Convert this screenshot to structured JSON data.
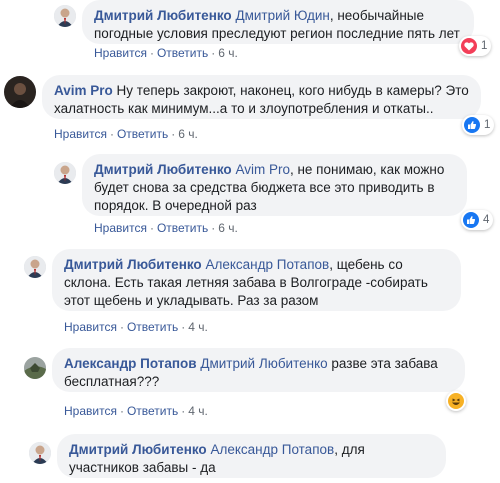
{
  "comments": [
    {
      "author": "Дмитрий Любитенко",
      "mention": "Дмитрий Юдин",
      "text": ", необычайные погодные условия преследуют регион последние пять лет",
      "like_label": "Нравится",
      "reply_label": "Ответить",
      "time": "6 ч.",
      "reaction": "love-icon",
      "reaction_count": "1"
    },
    {
      "author": "Avim Pro",
      "mention": "",
      "text": "Ну теперь закроют, наконец, кого нибудь в камеры? Это халатность как минимум...а то и злоупотребления и откаты..",
      "like_label": "Нравится",
      "reply_label": "Ответить",
      "time": "6 ч.",
      "reaction": "like-icon",
      "reaction_count": "1"
    },
    {
      "author": "Дмитрий Любитенко",
      "mention": "Avim Pro",
      "text": ", не понимаю, как можно будет снова за средства бюджета все это приводить в порядок. В очередной раз",
      "like_label": "Нравится",
      "reply_label": "Ответить",
      "time": "6 ч.",
      "reaction": "like-icon",
      "reaction_count": "4"
    },
    {
      "author": "Дмитрий Любитенко",
      "mention": "Александр Потапов",
      "text": ", щебень со склона. Есть такая летняя забава в Волгограде -собирать этот щебень и укладывать. Раз за разом",
      "like_label": "Нравится",
      "reply_label": "Ответить",
      "time": "4 ч.",
      "reaction": "",
      "reaction_count": ""
    },
    {
      "author": "Александр Потапов",
      "mention": "Дмитрий Любитенко",
      "text": " разве эта забава бесплатная???",
      "like_label": "Нравится",
      "reply_label": "Ответить",
      "time": "4 ч.",
      "reaction": "haha-icon",
      "reaction_count": ""
    },
    {
      "author": "Дмитрий Любитенко",
      "mention": "Александр Потапов",
      "text": ", для участников забавы - да",
      "like_label": "",
      "reply_label": "",
      "time": "",
      "reaction": "",
      "reaction_count": ""
    }
  ],
  "colors": {
    "link": "#385898",
    "bubble": "#f2f3f5",
    "meta": "#606770",
    "like": "#1877f2",
    "love": "#f33e58",
    "haha": "#f7b125"
  }
}
